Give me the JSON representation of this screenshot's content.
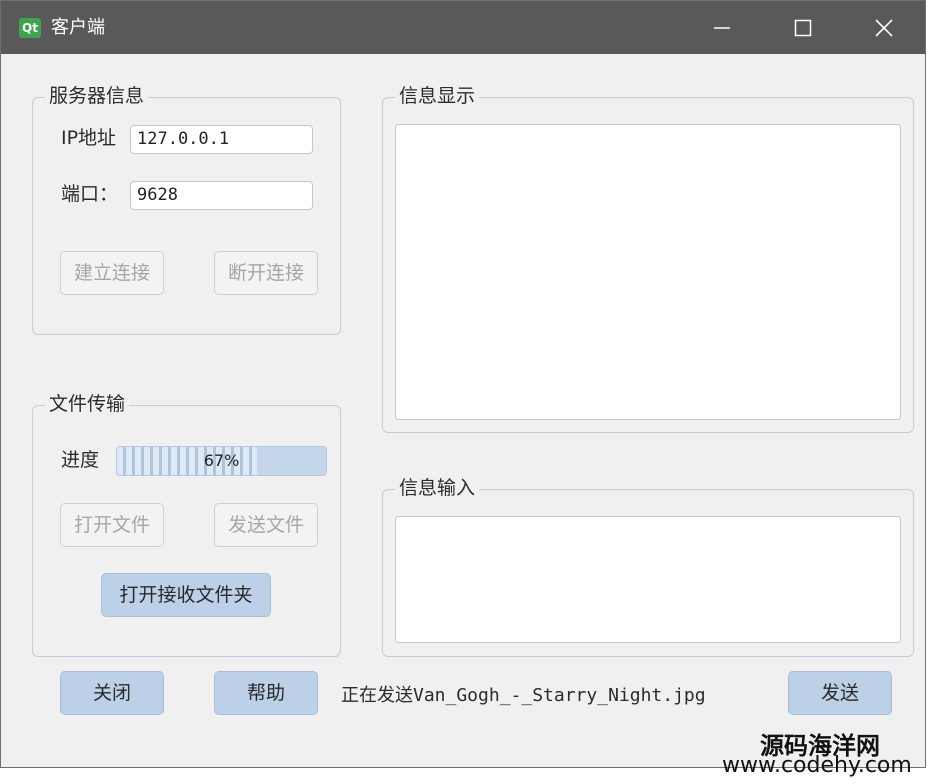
{
  "window": {
    "title": "客户端",
    "app_icon_text": "Qt"
  },
  "server_group": {
    "title": "服务器信息",
    "ip_label": "IP地址",
    "ip_value": "127.0.0.1",
    "port_label": "端口：",
    "port_value": "9628",
    "connect_label": "建立连接",
    "disconnect_label": "断开连接"
  },
  "file_group": {
    "title": "文件传输",
    "progress_label": "进度",
    "progress_value": 67,
    "progress_text": "67%",
    "open_file_label": "打开文件",
    "send_file_label": "发送文件",
    "open_folder_label": "打开接收文件夹"
  },
  "display_group": {
    "title": "信息显示",
    "content": ""
  },
  "input_group": {
    "title": "信息输入",
    "content": ""
  },
  "footer": {
    "close_label": "关闭",
    "help_label": "帮助",
    "status": "正在发送Van_Gogh_-_Starry_Night.jpg",
    "send_label": "发送"
  },
  "watermark": {
    "name": "源码海洋网",
    "url": "www.codehy.com"
  },
  "colors": {
    "titlebar": "#595959",
    "window_bg": "#f0f0f0",
    "primary_button": "#bcd1e8",
    "progress": "#c4d6ea"
  }
}
